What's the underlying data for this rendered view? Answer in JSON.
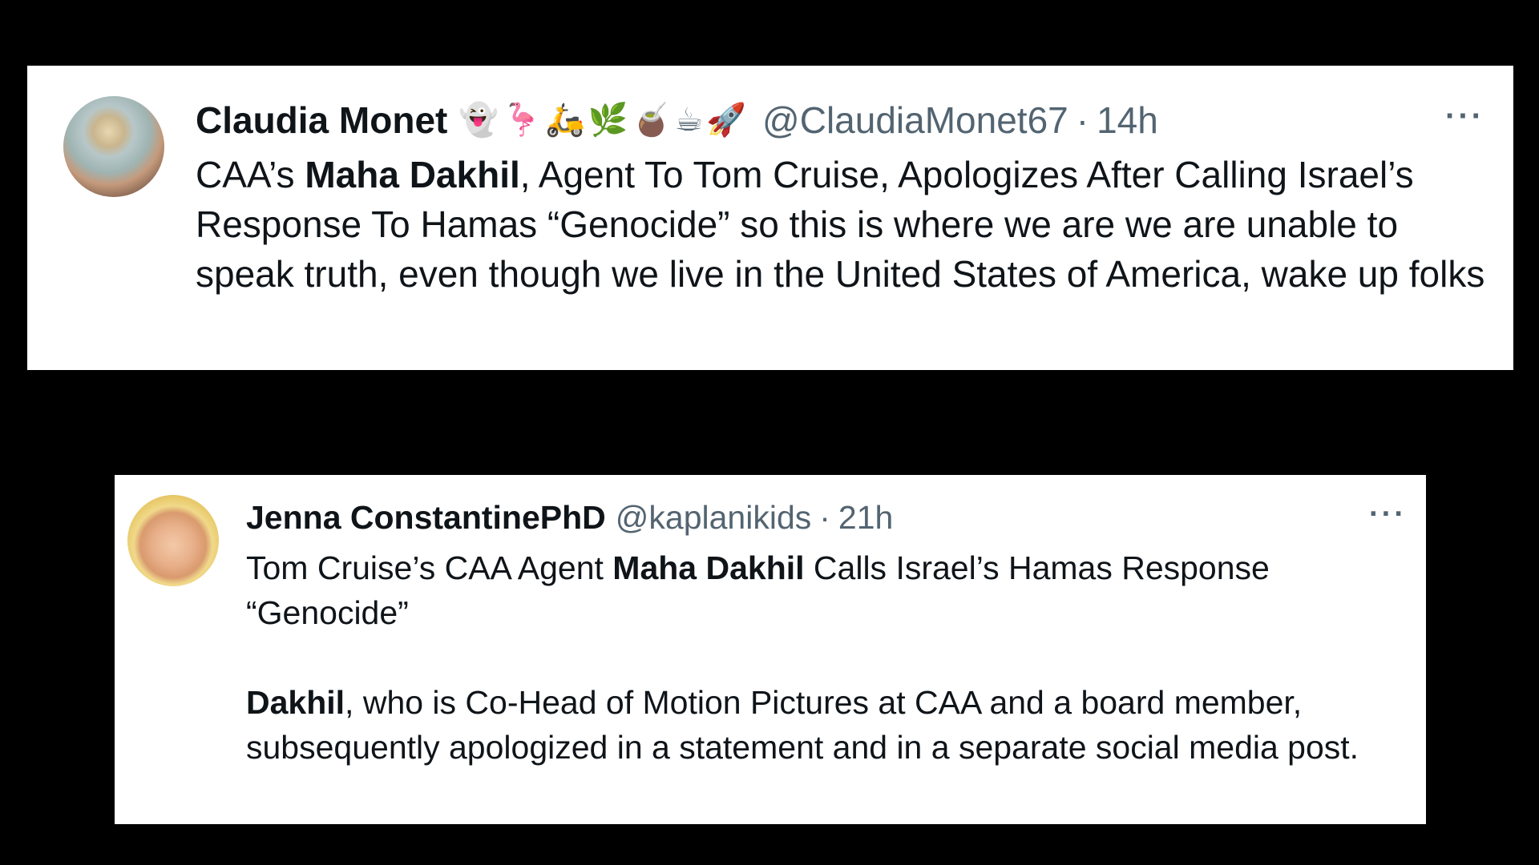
{
  "tweets": [
    {
      "author_name": "Claudia Monet",
      "author_emojis": "👻🦩🛵🌿🧉☕🚀",
      "handle": "@ClaudiaMonet67",
      "separator": "·",
      "time": "14h",
      "more_label": "···",
      "body": {
        "p1_part1": "CAA’s ",
        "p1_bold": "Maha Dakhil",
        "p1_part2": ", Agent To Tom Cruise, Apologizes After Calling Israel’s Response To Hamas “Genocide” so this is where we are we are unable to speak truth, even though we live in the United States of America, wake up folks"
      }
    },
    {
      "author_name": "Jenna ConstantinePhD",
      "handle": "@kaplanikids",
      "separator": "·",
      "time": "21h",
      "more_label": "···",
      "body": {
        "p1_part1": "Tom Cruise’s CAA Agent ",
        "p1_bold": "Maha Dakhil",
        "p1_part2": " Calls Israel’s Hamas Response “Genocide”",
        "p2_bold": "Dakhil",
        "p2_part1": ", who is Co-Head of Motion Pictures at CAA and a board member, subsequently apologized in a statement and in a separate social media post."
      }
    }
  ]
}
